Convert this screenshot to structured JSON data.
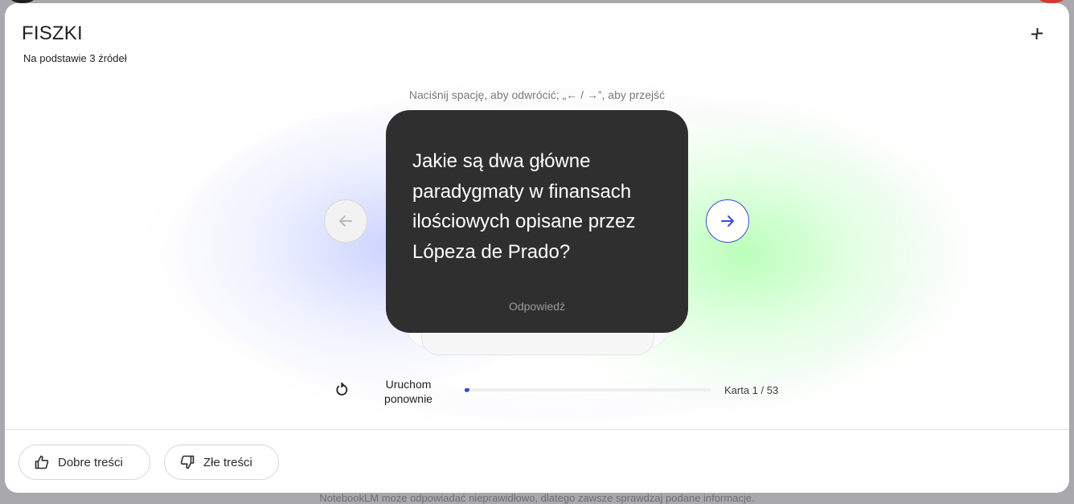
{
  "panel": {
    "title": "FISZKI",
    "subtitle": "Na podstawie 3 źródeł"
  },
  "flashcard": {
    "hint": "Naciśnij spację, aby odwrócić; „← / →”, aby przejść",
    "question": "Jakie są dwa główne paradygmaty w finansach ilościowych opisane przez Lópeza de Prado?",
    "answer_label": "Odpowiedź"
  },
  "controls": {
    "restart_label": "Uruchom ponownie",
    "card_counter": "Karta 1 / 53",
    "progress_fraction": 0.0189
  },
  "feedback": {
    "good_label": "Dobre treści",
    "bad_label": "Złe treści"
  },
  "disclaimer": "NotebookLM może odpowiadać nieprawidłowo, dlatego zawsze sprawdzaj podane informacje.",
  "colors": {
    "accent": "#3a4bd9",
    "card_background": "#2f2f2f"
  },
  "icons": {
    "collapse": "collapse-icon",
    "prev": "arrow-left-icon",
    "next": "arrow-right-icon",
    "restart": "restart-icon",
    "thumb_up": "thumb-up-icon",
    "thumb_down": "thumb-down-icon"
  }
}
